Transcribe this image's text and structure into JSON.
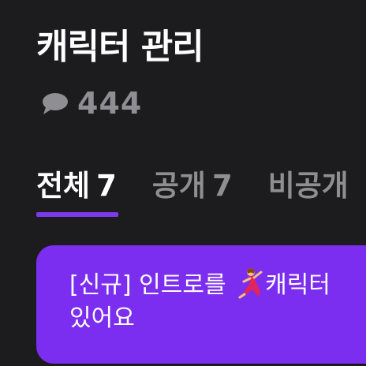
{
  "header": {
    "title": "캐릭터 관리"
  },
  "comments": {
    "icon": "speech-bubble-icon",
    "count": "444"
  },
  "tabs": [
    {
      "label": "전체",
      "count": "7",
      "active": true
    },
    {
      "label": "공개",
      "count": "7",
      "active": false
    },
    {
      "label": "비공개",
      "count": "",
      "active": false
    }
  ],
  "notice": {
    "text_before": "[신규] 인트로를 ",
    "emoji": "dancer-emoji",
    "text_after": "캐릭터",
    "text_line2": "있어요"
  },
  "colors": {
    "background": "#1c1c1e",
    "accent": "#7c3aed",
    "card": "#7c2ef0",
    "muted": "#8e8e93"
  }
}
